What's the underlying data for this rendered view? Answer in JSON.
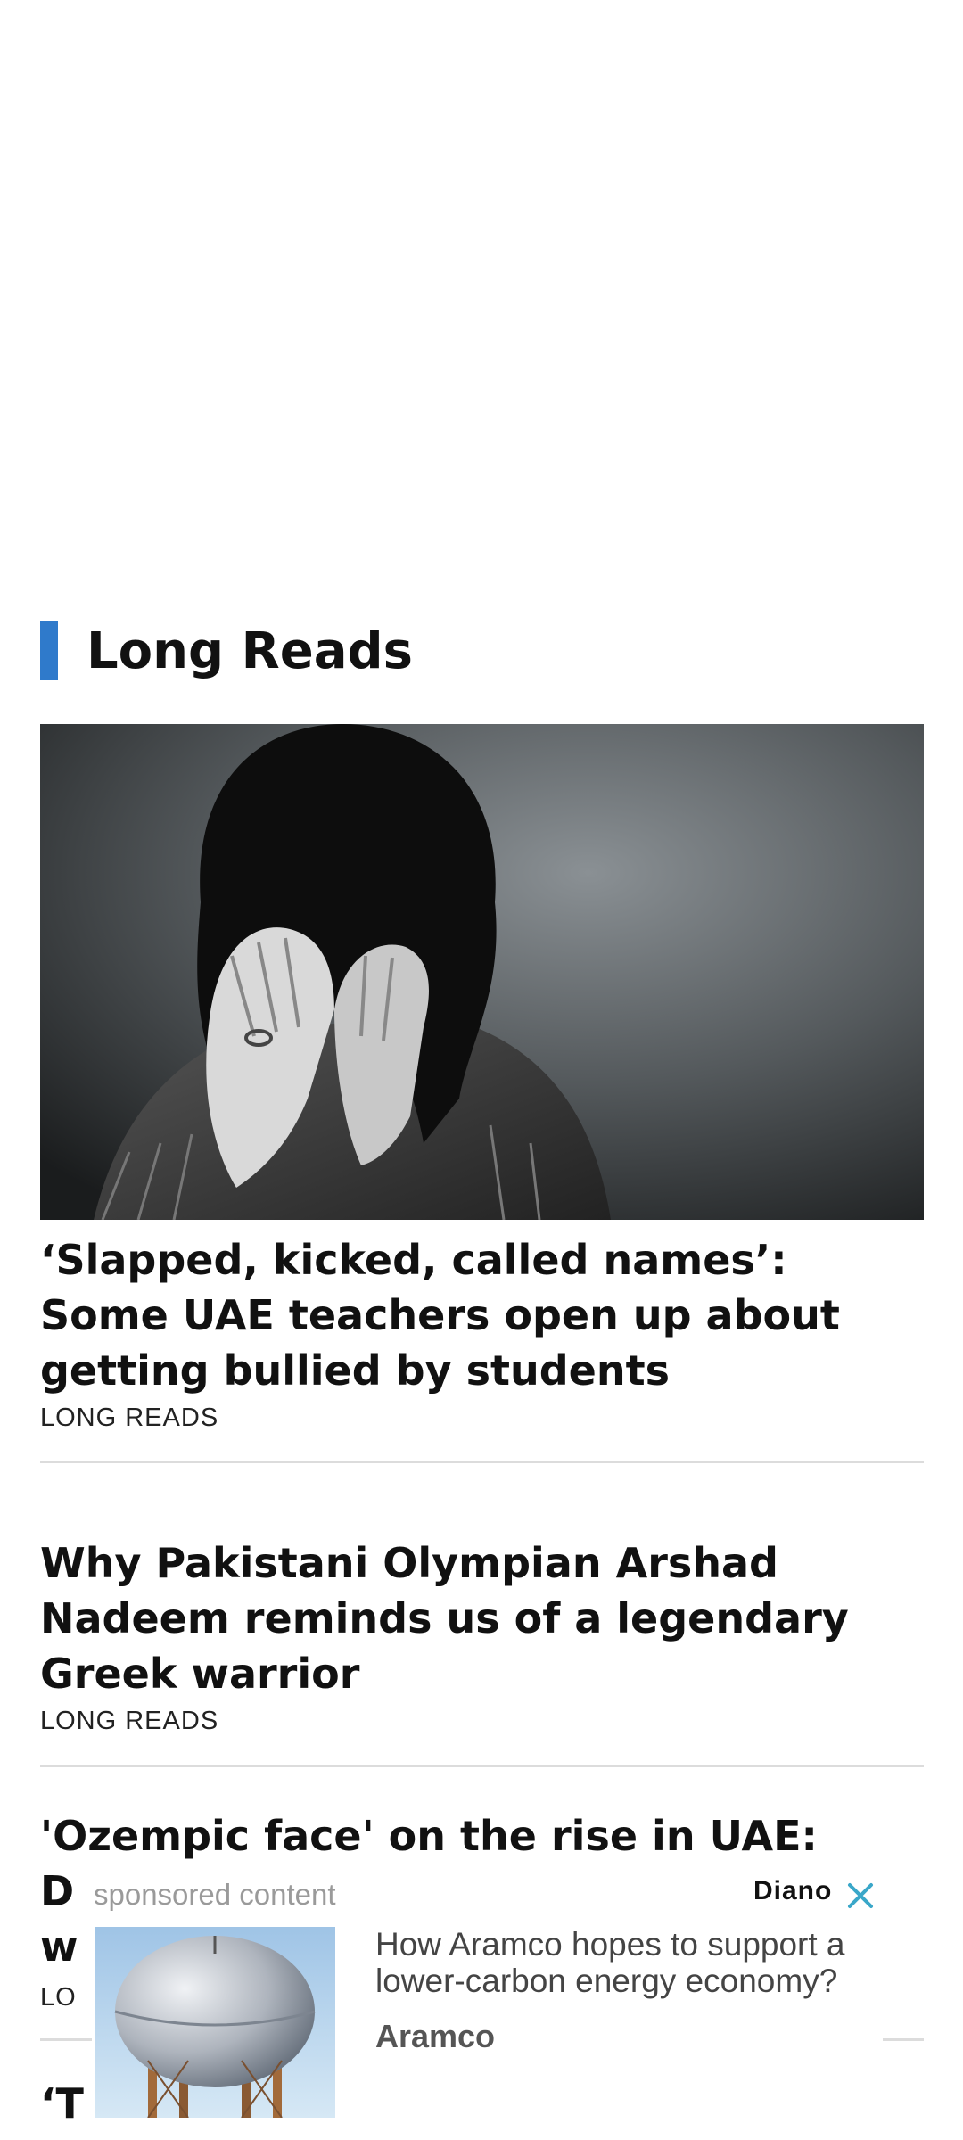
{
  "section": {
    "title": "Long Reads"
  },
  "articles": [
    {
      "headline": "‘Slapped, kicked, called names’: Some UAE teachers open up about getting bullied by students",
      "category": "LONG READS"
    },
    {
      "headline": "Why Pakistani Olympian Arshad Nadeem reminds us of a legendary Greek warrior",
      "category": "LONG READS"
    },
    {
      "headline_visible": "'Ozempic face' on the rise in UAE:",
      "line2_fragment": "D",
      "line3_fragment": "w",
      "category_fragment": "LO"
    },
    {
      "headline_fragment": "‘T"
    }
  ],
  "ad": {
    "label": "sponsored content",
    "logo": "Diano",
    "headline": "How Aramco hopes to support a lower-carbon energy economy?",
    "source": "Aramco",
    "close_icon": "close-icon",
    "accent": "#3aa7c9"
  },
  "colors": {
    "section_bar": "#2f7acb"
  }
}
